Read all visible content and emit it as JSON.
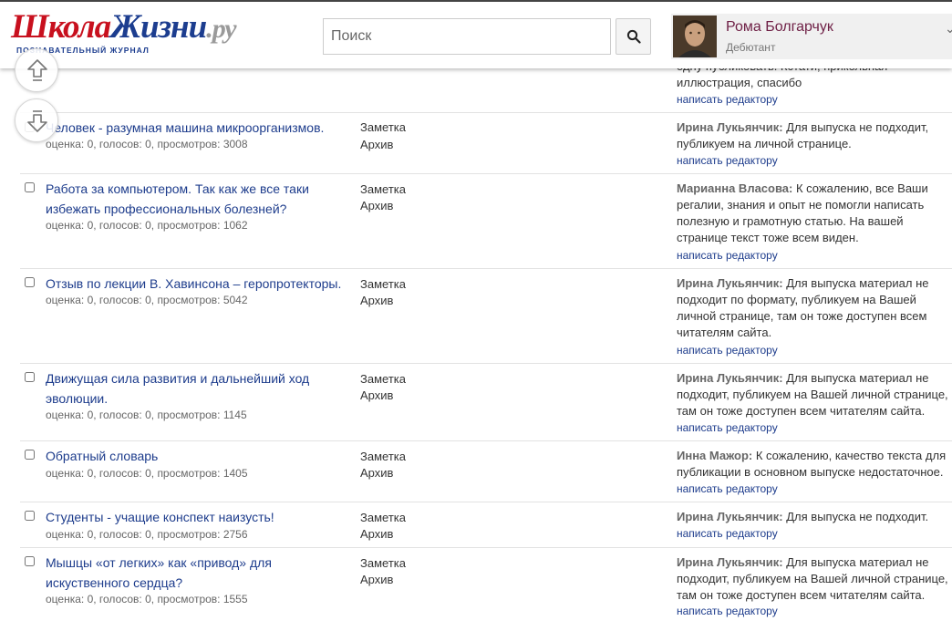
{
  "header": {
    "logo_part1": "Школа",
    "logo_part2": "Жизни",
    "logo_part3": ".ру",
    "logo_subtitle": "ПОЗНАВАТЕЛЬНЫЙ ЖУРНАЛ",
    "search_placeholder": "Поиск",
    "user_name": "Рома Болгарчук",
    "user_rank": "Дебютант"
  },
  "icons": {
    "search": "search-icon",
    "scroll_up": "arrow-up-icon",
    "scroll_down": "arrow-down-icon",
    "menu": "chevron-down-icon"
  },
  "first_row": {
    "comment_tail_1": "одну публиковать. Кстати, прикольная",
    "comment_tail_2": "иллюстрация, спасибо",
    "link": "написать редактору"
  },
  "rows": [
    {
      "title": "Человек - разумная машина микроорганизмов.",
      "meta": "оценка: 0, голосов: 0, просмотров: 3008",
      "type": "Заметка",
      "status": "Архив",
      "author": "Ирина Лукьянчик:",
      "comment": " Для выпуска не подходит, публикуем на личной странице.",
      "link": "написать редактору"
    },
    {
      "title": "Работа за компьютером. Так как же все таки избежать профессиональных болезней?",
      "meta": "оценка: 0, голосов: 0, просмотров: 1062",
      "type": "Заметка",
      "status": "Архив",
      "author": "Марианна Власова:",
      "comment": " К сожалению, все Ваши регалии, знания и опыт не помогли написать полезную и грамотную статью. На вашей странице текст тоже всем виден.",
      "link": "написать редактору"
    },
    {
      "title": "Отзыв по лекции В. Хавинсона – геропротекторы.",
      "meta": "оценка: 0, голосов: 0, просмотров: 5042",
      "type": "Заметка",
      "status": "Архив",
      "author": "Ирина Лукьянчик:",
      "comment": " Для выпуска материал не подходит по формату, публикуем на Вашей личной странице, там он тоже доступен всем читателям сайта.",
      "link": "написать редактору"
    },
    {
      "title": "Движущая сила развития и дальнейший ход эволюции.",
      "meta": "оценка: 0, голосов: 0, просмотров: 1145",
      "type": "Заметка",
      "status": "Архив",
      "author": "Ирина Лукьянчик:",
      "comment": " Для выпуска материал не подходит, публикуем на Вашей личной странице, там он тоже доступен всем читателям сайта.",
      "link": "написать редактору"
    },
    {
      "title": "Обратный словарь",
      "meta": "оценка: 0, голосов: 0, просмотров: 1405",
      "type": "Заметка",
      "status": "Архив",
      "author": "Инна Мажор:",
      "comment": " К сожалению, качество текста для публикации в основном выпуске недостаточное.",
      "link": "написать редактору"
    },
    {
      "title": "Студенты - учащие конспект наизусть!",
      "meta": "оценка: 0, голосов: 0, просмотров: 2756",
      "type": "Заметка",
      "status": "Архив",
      "author": "Ирина Лукьянчик:",
      "comment": " Для выпуска не подходит.",
      "link": "написать редактору"
    },
    {
      "title": "Мышцы «от легких» как «привод» для искуственного сердца?",
      "meta": "оценка: 0, голосов: 0, просмотров: 1555",
      "type": "Заметка",
      "status": "Архив",
      "author": "Ирина Лукьянчик:",
      "comment": " Для выпуска материал не подходит, публикуем на Вашей личной странице, там он тоже доступен всем читателям сайта.",
      "link": "написать редактору"
    }
  ]
}
